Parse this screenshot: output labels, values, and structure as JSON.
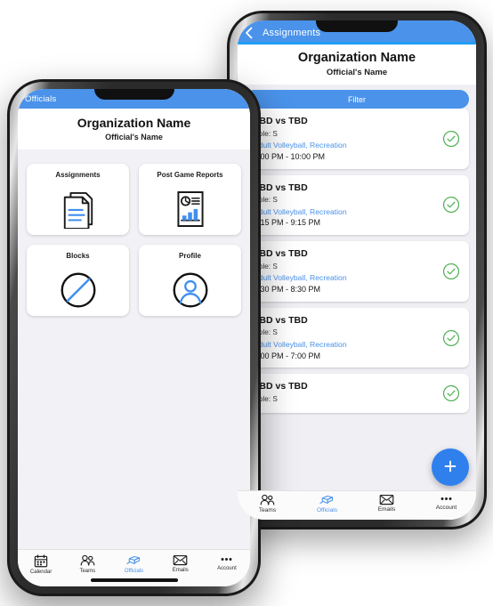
{
  "theme": {
    "header_blue": "#4a92ea",
    "accent_blue": "#2f80ed",
    "link_blue": "#4a92ea",
    "underline_blue": "#1e9ef5",
    "check_green": "#4caf50",
    "screen_bg": "#efeff4",
    "card_bg": "#ffffff"
  },
  "back_phone": {
    "appbar": {
      "back_icon": "chevron-left-icon",
      "title": "Assignments"
    },
    "org_header": {
      "organization": "Organization Name",
      "official": "Official's Name"
    },
    "filter_button": "Filter",
    "fab": {
      "icon": "plus-icon",
      "label": "+"
    },
    "assignments": [
      {
        "matchup": "TBD vs TBD",
        "role": "Role: S",
        "league": "Adult Volleyball, Recreation",
        "time": "9:00 PM - 10:00 PM",
        "status_icon": "check-circle-icon"
      },
      {
        "matchup": "TBD vs TBD",
        "role": "Role: S",
        "league": "Adult Volleyball, Recreation",
        "time": "8:15 PM - 9:15 PM",
        "status_icon": "check-circle-icon"
      },
      {
        "matchup": "TBD vs TBD",
        "role": "Role: S",
        "league": "Adult Volleyball, Recreation",
        "time": "7:30 PM - 8:30 PM",
        "status_icon": "check-circle-icon"
      },
      {
        "matchup": "TBD vs TBD",
        "role": "Role: S",
        "league": "Adult Volleyball, Recreation",
        "time": "6:00 PM - 7:00 PM",
        "status_icon": "check-circle-icon"
      },
      {
        "matchup": "TBD vs TBD",
        "role": "Role: S",
        "league": "",
        "time": "",
        "status_icon": "check-circle-icon"
      }
    ],
    "bottom_nav": [
      {
        "label": "Teams",
        "icon": "people-icon",
        "active": false
      },
      {
        "label": "Officials",
        "icon": "whistle-icon",
        "active": true
      },
      {
        "label": "Emails",
        "icon": "envelope-icon",
        "active": false
      },
      {
        "label": "Account",
        "icon": "ellipsis-icon",
        "active": false
      }
    ]
  },
  "front_phone": {
    "appbar": {
      "title": "Officials"
    },
    "org_header": {
      "organization": "Organization Name",
      "official": "Official's Name"
    },
    "tiles": [
      {
        "label": "Assignments",
        "icon": "documents-icon"
      },
      {
        "label": "Post Game Reports",
        "icon": "report-chart-icon"
      },
      {
        "label": "Blocks",
        "icon": "block-circle-icon"
      },
      {
        "label": "Profile",
        "icon": "person-circle-icon"
      }
    ],
    "bottom_nav": [
      {
        "label": "Calendar",
        "icon": "calendar-icon",
        "active": false
      },
      {
        "label": "Teams",
        "icon": "people-icon",
        "active": false
      },
      {
        "label": "Officials",
        "icon": "whistle-icon",
        "active": true
      },
      {
        "label": "Emails",
        "icon": "envelope-icon",
        "active": false
      },
      {
        "label": "Account",
        "icon": "ellipsis-icon",
        "active": false
      }
    ]
  }
}
